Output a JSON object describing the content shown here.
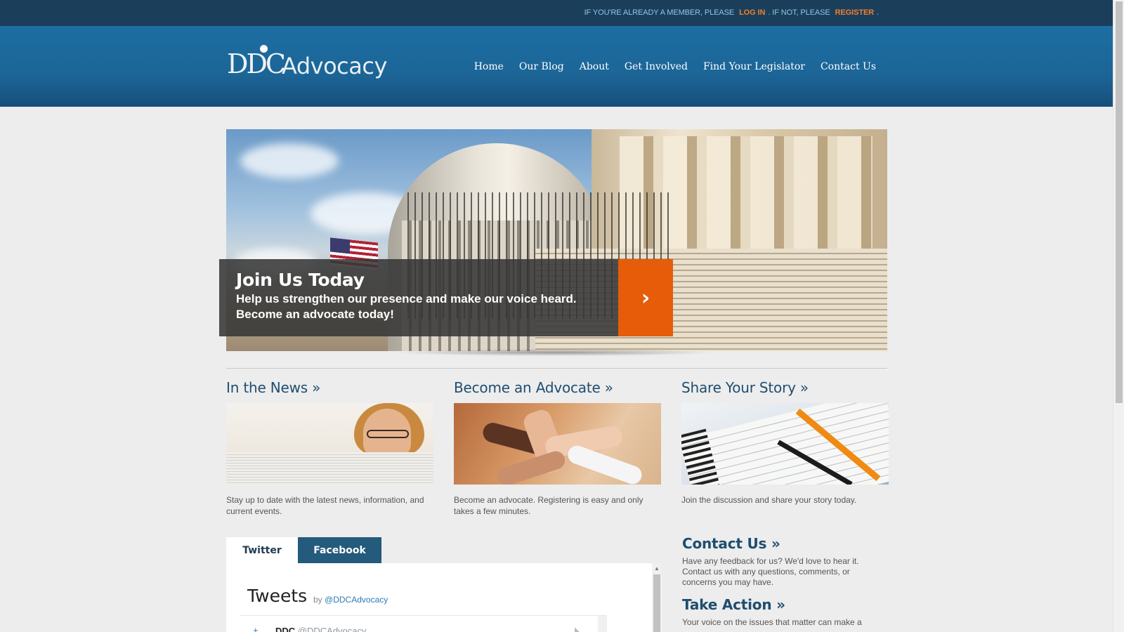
{
  "topbar": {
    "prefix": "IF YOU'RE ALREADY A MEMBER, PLEASE",
    "login": "LOG IN",
    "middle": ". IF NOT, PLEASE",
    "register": "REGISTER",
    "suffix": "."
  },
  "logo": {
    "ddc": "DDC",
    "advocacy": "Advocacy"
  },
  "nav": [
    "Home",
    "Our Blog",
    "About",
    "Get Involved",
    "Find Your Legislator",
    "Contact Us"
  ],
  "hero": {
    "title": "Join Us Today",
    "line1": "Help us strengthen our presence and make our voice heard.",
    "line2": "Become an advocate today!",
    "button_icon": "chevron-right-icon"
  },
  "features": [
    {
      "title": "In the News »",
      "text": "Stay up to date with the latest news, information, and current events."
    },
    {
      "title": "Become an Advocate »",
      "text": "Become an advocate. Registering is easy and only takes a few minutes."
    },
    {
      "title": "Share Your Story »",
      "text": "Join the discussion and share your story today."
    }
  ],
  "tabs": {
    "twitter": "Twitter",
    "facebook": "Facebook"
  },
  "tweets": {
    "title": "Tweets",
    "by": "by",
    "handle": "@DDCAdvocacy",
    "user_name": "DDC",
    "user_handle": "@DDCAdvocacy"
  },
  "sidebar": {
    "contact_title": "Contact Us »",
    "contact_text": "Have any feedback for us? We'd love to hear it. Contact us with any questions, comments, or concerns you may have.",
    "action_title": "Take Action »",
    "action_text": "Your voice on the issues that matter can make a"
  },
  "colors": {
    "topbar_bg": "#1b3f5b",
    "header_bg": "#1d6ea3",
    "accent_orange": "#e65c08",
    "heading_blue": "#1f4e70"
  }
}
